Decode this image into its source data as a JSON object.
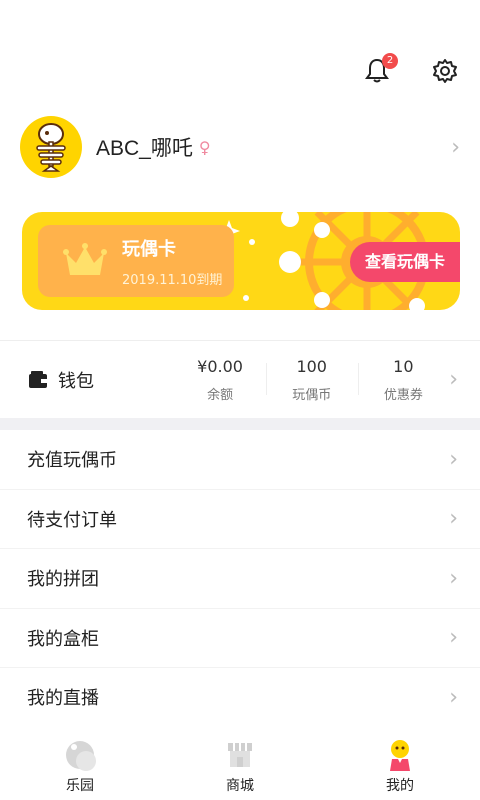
{
  "header": {
    "notification_count": "2"
  },
  "profile": {
    "username": "ABC_哪吒",
    "gender_symbol": "♀"
  },
  "card": {
    "title": "玩偶卡",
    "expiry": "2019.11.10到期",
    "button": "查看玩偶卡"
  },
  "wallet": {
    "label": "钱包",
    "stats": [
      {
        "value": "¥0.00",
        "label": "余额"
      },
      {
        "value": "100",
        "label": "玩偶币"
      },
      {
        "value": "10",
        "label": "优惠券"
      }
    ]
  },
  "menu": [
    {
      "label": "充值玩偶币"
    },
    {
      "label": "待支付订单"
    },
    {
      "label": "我的拼团"
    },
    {
      "label": "我的盒柜"
    },
    {
      "label": "我的直播"
    }
  ],
  "tabs": [
    {
      "label": "乐园",
      "icon": "planet-icon"
    },
    {
      "label": "商城",
      "icon": "shop-icon"
    },
    {
      "label": "我的",
      "icon": "me-icon"
    }
  ],
  "colors": {
    "accent": "#ffd816",
    "card_inner": "#ffb24b",
    "button": "#f4486b",
    "badge": "#f24b4b"
  }
}
